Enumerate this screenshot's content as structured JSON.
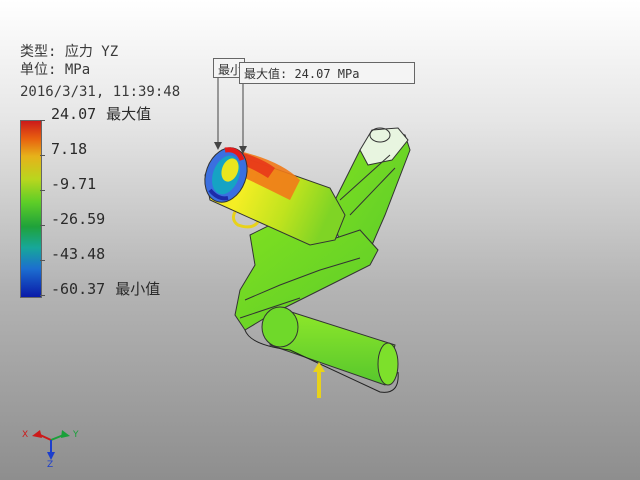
{
  "header": {
    "type_line": "类型: 应力 YZ",
    "unit_line": "单位: MPa",
    "timestamp": "2016/3/31, 11:39:48"
  },
  "legend": {
    "labels": [
      {
        "value": "24.07",
        "tag": "最大值"
      },
      {
        "value": "7.18",
        "tag": ""
      },
      {
        "value": "-9.71",
        "tag": ""
      },
      {
        "value": "-26.59",
        "tag": ""
      },
      {
        "value": "-43.48",
        "tag": ""
      },
      {
        "value": "-60.37",
        "tag": "最小值"
      }
    ]
  },
  "callouts": {
    "back_label": "最小",
    "front_label": "最大值: 24.07 MPa"
  },
  "triad": {
    "x_label": "X",
    "y_label": "Y",
    "z_label": "Z"
  }
}
